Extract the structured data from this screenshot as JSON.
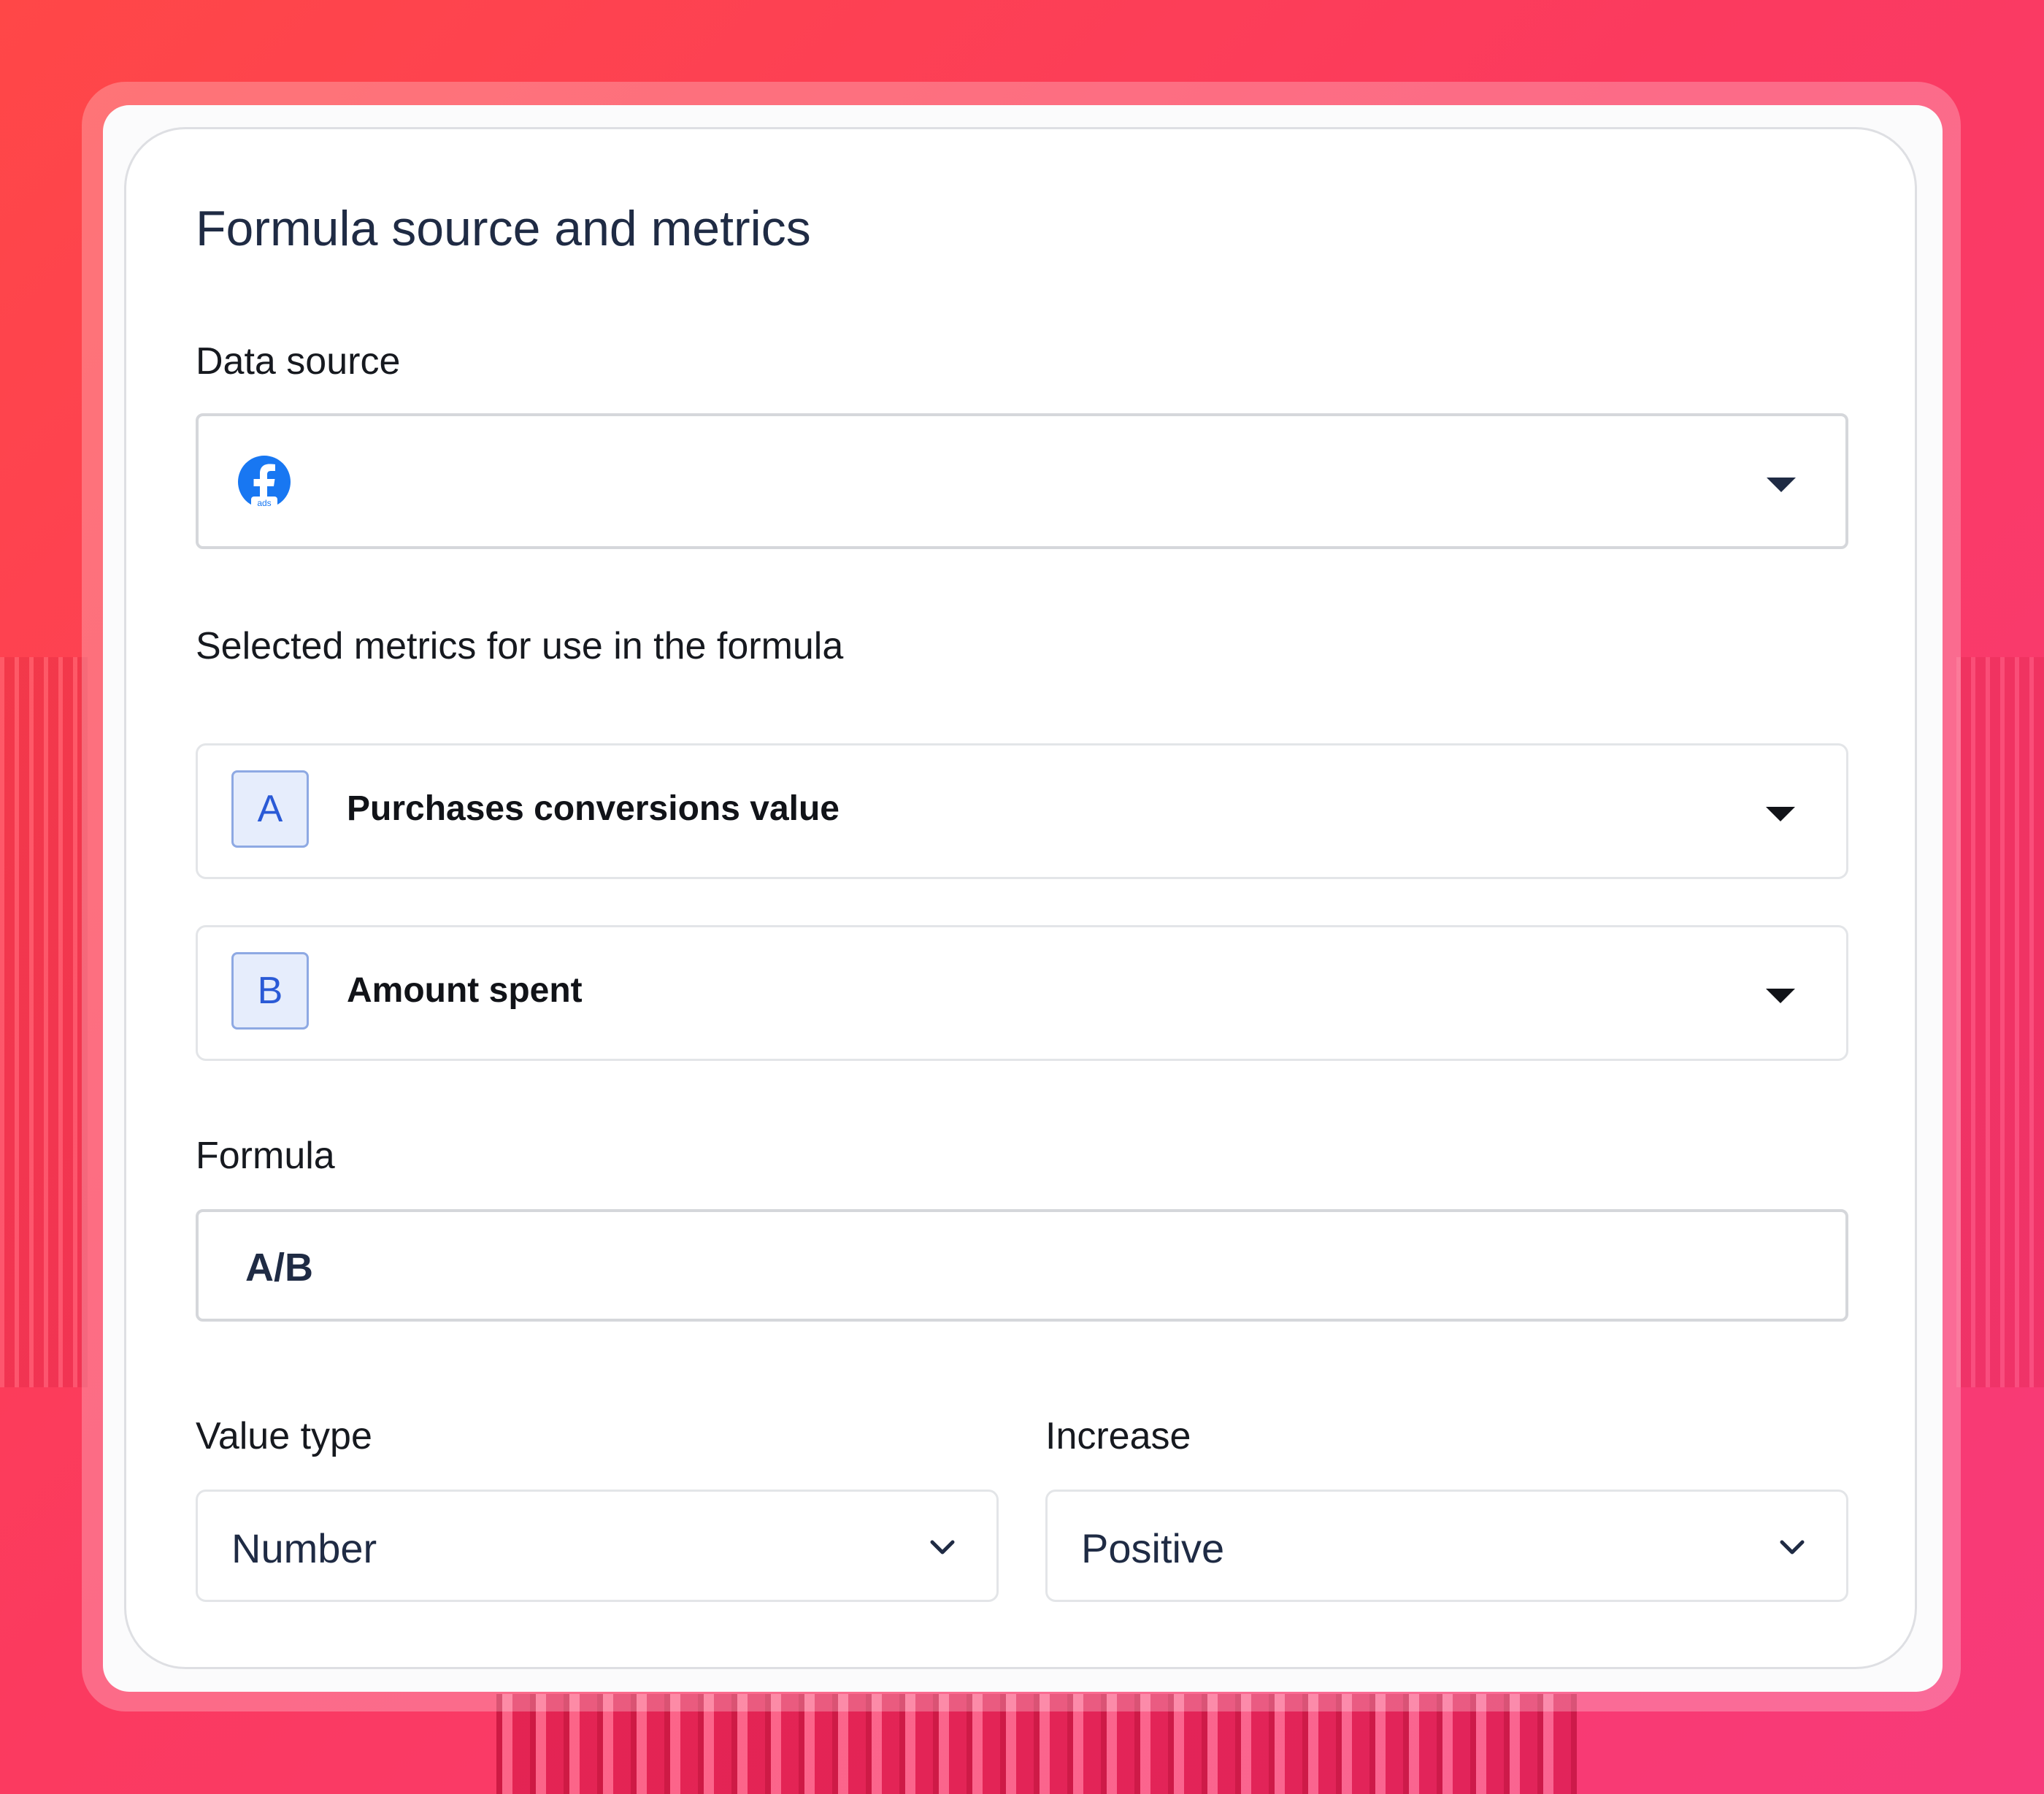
{
  "card": {
    "title": "Formula source and metrics"
  },
  "data_source": {
    "label": "Data source",
    "icon": "facebook-ads-icon",
    "icon_caption": "ads"
  },
  "metrics": {
    "label": "Selected metrics for use in the formula",
    "items": [
      {
        "badge": "A",
        "name": "Purchases conversions value"
      },
      {
        "badge": "B",
        "name": "Amount spent"
      }
    ]
  },
  "formula": {
    "label": "Formula",
    "value": "A/B"
  },
  "value_type": {
    "label": "Value type",
    "selected": "Number"
  },
  "increase": {
    "label": "Increase",
    "selected": "Positive"
  },
  "colors": {
    "background_gradient": [
      "#ff4747",
      "#f73a7a"
    ],
    "title_text": "#1f2b44",
    "badge_bg": "#e6edfc",
    "badge_text": "#2a5ad6",
    "facebook_blue": "#1877f2"
  }
}
